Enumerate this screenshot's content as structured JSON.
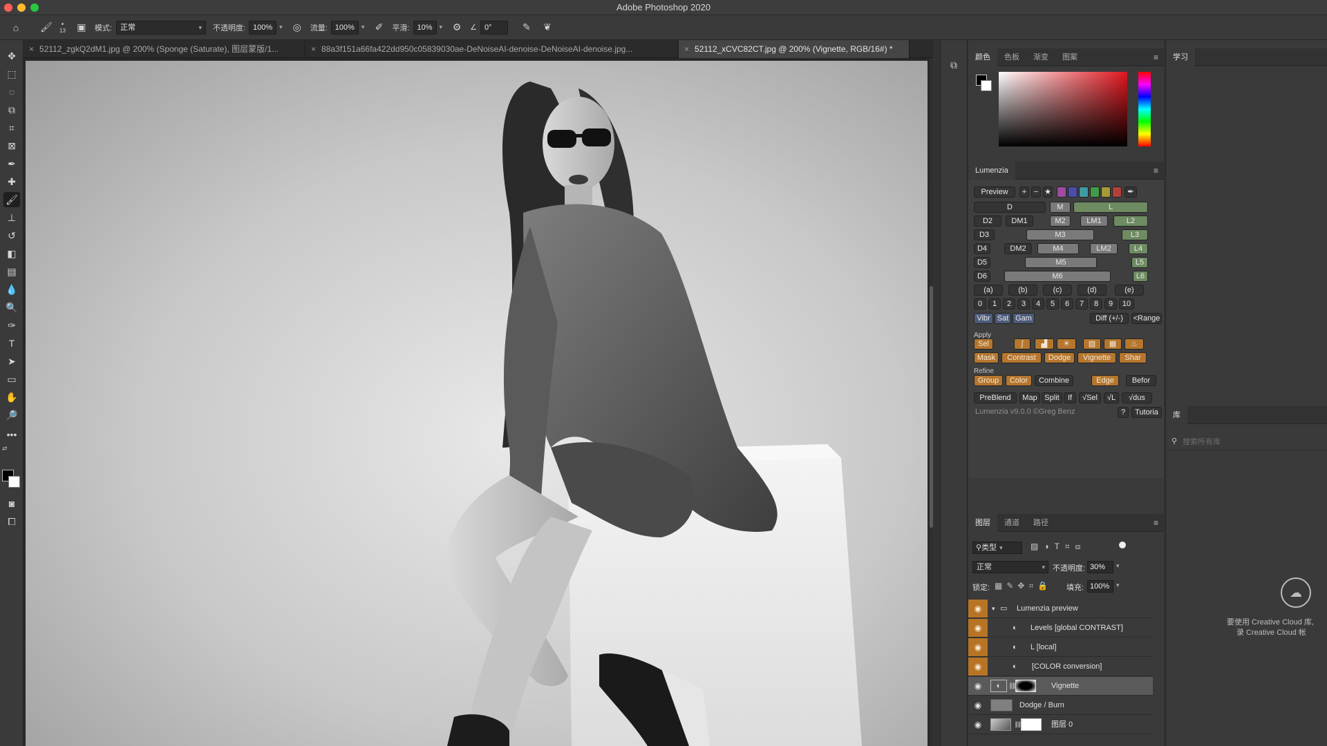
{
  "app": {
    "title": "Adobe Photoshop 2020"
  },
  "options_bar": {
    "brush_size": "13",
    "mode_label": "模式:",
    "mode_value": "正常",
    "opacity_label": "不透明度:",
    "opacity_value": "100%",
    "flow_label": "流量:",
    "flow_value": "100%",
    "smooth_label": "平滑:",
    "smooth_value": "10%",
    "angle_value": "0°"
  },
  "tabs": [
    {
      "label": "52112_zgkQ2dM1.jpg @ 200% (Sponge (Saturate), 图层蒙版/1..."
    },
    {
      "label": "88a3f151a66fa422dd950c05839030ae-DeNoiseAI-denoise-DeNoiseAI-denoise.jpg..."
    },
    {
      "label": "52112_xCVC82CT.jpg @ 200% (Vignette, RGB/16#) *"
    }
  ],
  "color_panel": {
    "tabs": [
      "颜色",
      "色板",
      "渐变",
      "图案"
    ]
  },
  "learn_panel": {
    "tab": "学习"
  },
  "lumenzia": {
    "title": "Lumenzia",
    "preview": "Preview",
    "row1": [
      "D",
      "M",
      "L"
    ],
    "row2": [
      "D2",
      "DM1",
      "M2",
      "LM1",
      "L2"
    ],
    "row3": [
      "D3",
      "M3",
      "L3"
    ],
    "row4": [
      "D4",
      "DM2",
      "M4",
      "LM2",
      "L4"
    ],
    "row5": [
      "D5",
      "M5",
      "L5"
    ],
    "row6": [
      "D6",
      "M6",
      "L6"
    ],
    "letters": [
      "(a)",
      "(b)",
      "(c)",
      "(d)",
      "(e)"
    ],
    "numbers": [
      "0",
      "1",
      "2",
      "3",
      "4",
      "5",
      "6",
      "7",
      "8",
      "9",
      "10"
    ],
    "vibr": "Vibr",
    "sat": "Sat",
    "gam": "Gam",
    "diff": "Diff (+/-)",
    "range": "<Range",
    "apply_label": "Apply",
    "sel": "Sel",
    "apply_row": [
      "Mask",
      "Contrast",
      "Dodge",
      "Vignette",
      "Shar"
    ],
    "refine_label": "Refine",
    "refine_row": [
      "Group",
      "Color",
      "Combine",
      "Edge",
      "Befor"
    ],
    "bottom_row": [
      "PreBlend",
      "Map",
      "Split",
      "If",
      "√Sel",
      "√L",
      "√dus"
    ],
    "version": "Lumenzia v9.0.0 ©Greg Benz",
    "help": "?",
    "tutorial": "Tutoria"
  },
  "layers_panel": {
    "tabs": [
      "图层",
      "通道",
      "路径"
    ],
    "filter_label": "类型",
    "blend_mode": "正常",
    "opacity_label": "不透明度:",
    "opacity_value": "30%",
    "lock_label": "锁定:",
    "fill_label": "填充:",
    "fill_value": "100%",
    "layers": [
      {
        "name": "Lumenzia preview"
      },
      {
        "name": "Levels [global CONTRAST]"
      },
      {
        "name": "L [local]"
      },
      {
        "name": "[COLOR conversion]"
      },
      {
        "name": "Vignette"
      },
      {
        "name": "Dodge / Burn"
      },
      {
        "name": "图层 0"
      }
    ]
  },
  "library_panel": {
    "tab": "库",
    "search_placeholder": "搜索所有库",
    "message_line1": "要使用 Creative Cloud 库,",
    "message_line2": "录 Creative Cloud 帐"
  },
  "colors": {
    "accent_orange": "#b87425",
    "lumenzia_green": "#6e8b62",
    "lumenzia_orange": "#b5762e"
  }
}
